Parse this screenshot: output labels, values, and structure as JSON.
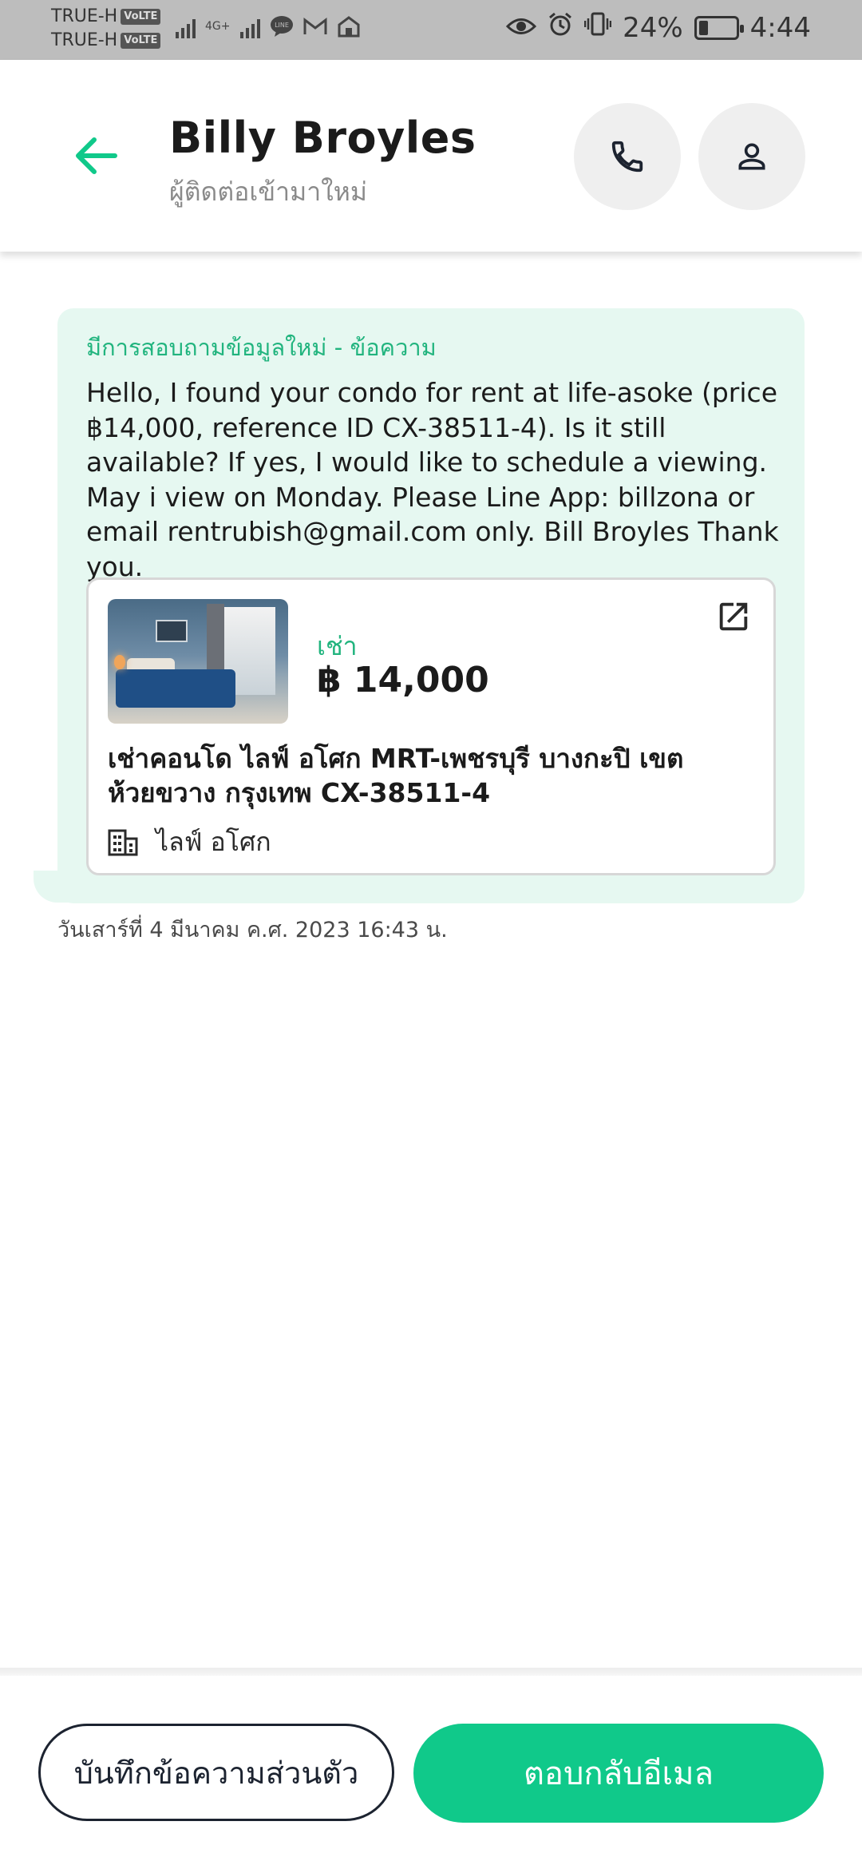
{
  "status_bar": {
    "carrier1": "TRUE-H",
    "carrier2": "TRUE-H",
    "volte": "VoLTE",
    "network": "4G+",
    "battery_percent": "24%",
    "battery_level": 0.24,
    "time": "4:44"
  },
  "header": {
    "contact_name": "Billy Broyles",
    "contact_subtitle": "ผู้ติดต่อเข้ามาใหม่"
  },
  "message": {
    "title": "มีการสอบถามข้อมูลใหม่ - ข้อความ",
    "body": "Hello, I found your condo for rent at life-asoke (price ฿14,000, reference ID CX-38511-4). Is it still available? If yes, I would like to schedule a viewing. May i view on Monday. Please Line App: billzona or email rentrubish@gmail.com only. Bill Broyles Thank you.",
    "timestamp": "วันเสาร์ที่ 4 มีนาคม ค.ศ. 2023 16:43 น."
  },
  "listing": {
    "type": "เช่า",
    "price": "฿ 14,000",
    "title": "เช่าคอนโด  ไลฟ์ อโศก MRT-เพชรบุรี บางกะปิ เขตห้วยขวาง กรุงเทพ CX-38511-4",
    "project": "ไลฟ์ อโศก"
  },
  "actions": {
    "note_label": "บันทึกข้อความส่วนตัว",
    "reply_label": "ตอบกลับอีเมล"
  },
  "colors": {
    "accent": "#10c98a",
    "bubble_bg": "#e6f8f1",
    "label_green": "#21b47e"
  },
  "icons": {
    "back": "arrow-left-icon",
    "call": "phone-icon",
    "profile": "person-icon",
    "open": "external-link-icon",
    "project": "building-icon"
  }
}
